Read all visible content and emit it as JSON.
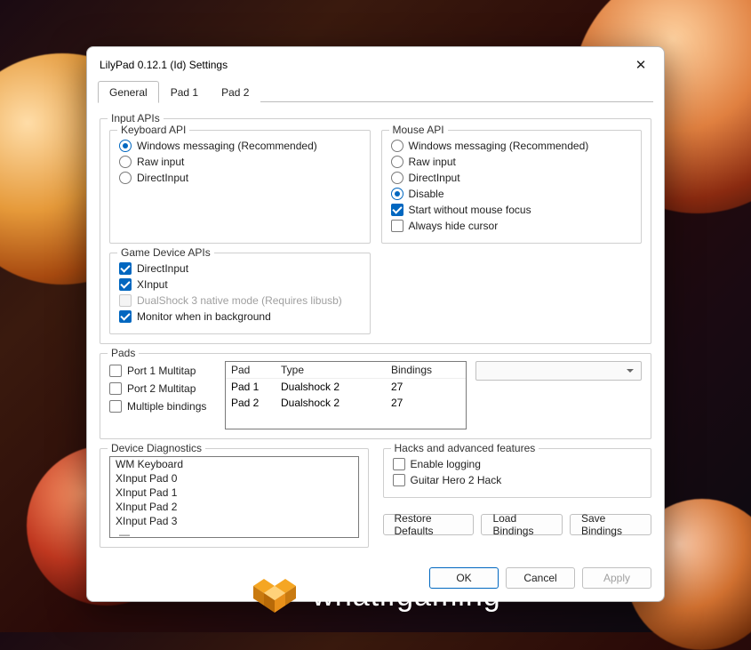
{
  "window": {
    "title": "LilyPad 0.12.1 (Id) Settings"
  },
  "tabs": [
    "General",
    "Pad 1",
    "Pad 2"
  ],
  "active_tab": 0,
  "input_apis": {
    "legend": "Input APIs",
    "keyboard": {
      "legend": "Keyboard API",
      "options": [
        "Windows messaging (Recommended)",
        "Raw input",
        "DirectInput"
      ],
      "selected": 0
    },
    "mouse": {
      "legend": "Mouse API",
      "options": [
        "Windows messaging (Recommended)",
        "Raw input",
        "DirectInput",
        "Disable"
      ],
      "selected": 3,
      "checks": [
        {
          "label": "Start without mouse focus",
          "checked": true
        },
        {
          "label": "Always hide cursor",
          "checked": false
        }
      ]
    },
    "gamedev": {
      "legend": "Game Device APIs",
      "checks": [
        {
          "label": "DirectInput",
          "checked": true,
          "disabled": false
        },
        {
          "label": "XInput",
          "checked": true,
          "disabled": false
        },
        {
          "label": "DualShock 3 native mode (Requires libusb)",
          "checked": false,
          "disabled": true
        },
        {
          "label": "Monitor when in background",
          "checked": true,
          "disabled": false
        }
      ]
    }
  },
  "pads": {
    "legend": "Pads",
    "side_checks": [
      {
        "label": "Port 1 Multitap",
        "checked": false
      },
      {
        "label": "Port 2 Multitap",
        "checked": false
      },
      {
        "label": "Multiple bindings",
        "checked": false
      }
    ],
    "columns": [
      "Pad",
      "Type",
      "Bindings"
    ],
    "rows": [
      {
        "pad": "Pad 1",
        "type": "Dualshock 2",
        "bindings": "27"
      },
      {
        "pad": "Pad 2",
        "type": "Dualshock 2",
        "bindings": "27"
      }
    ]
  },
  "diagnostics": {
    "legend": "Device Diagnostics",
    "items": [
      "WM Keyboard",
      "XInput Pad 0",
      "XInput Pad 1",
      "XInput Pad 2",
      "XInput Pad 3"
    ]
  },
  "hacks": {
    "legend": "Hacks and advanced features",
    "checks": [
      {
        "label": "Enable logging",
        "checked": false
      },
      {
        "label": "Guitar Hero 2 Hack",
        "checked": false
      }
    ]
  },
  "action_buttons": [
    "Restore Defaults",
    "Load Bindings",
    "Save Bindings"
  ],
  "dialog_buttons": {
    "ok": "OK",
    "cancel": "Cancel",
    "apply": "Apply"
  },
  "watermark": "whatifgaming"
}
